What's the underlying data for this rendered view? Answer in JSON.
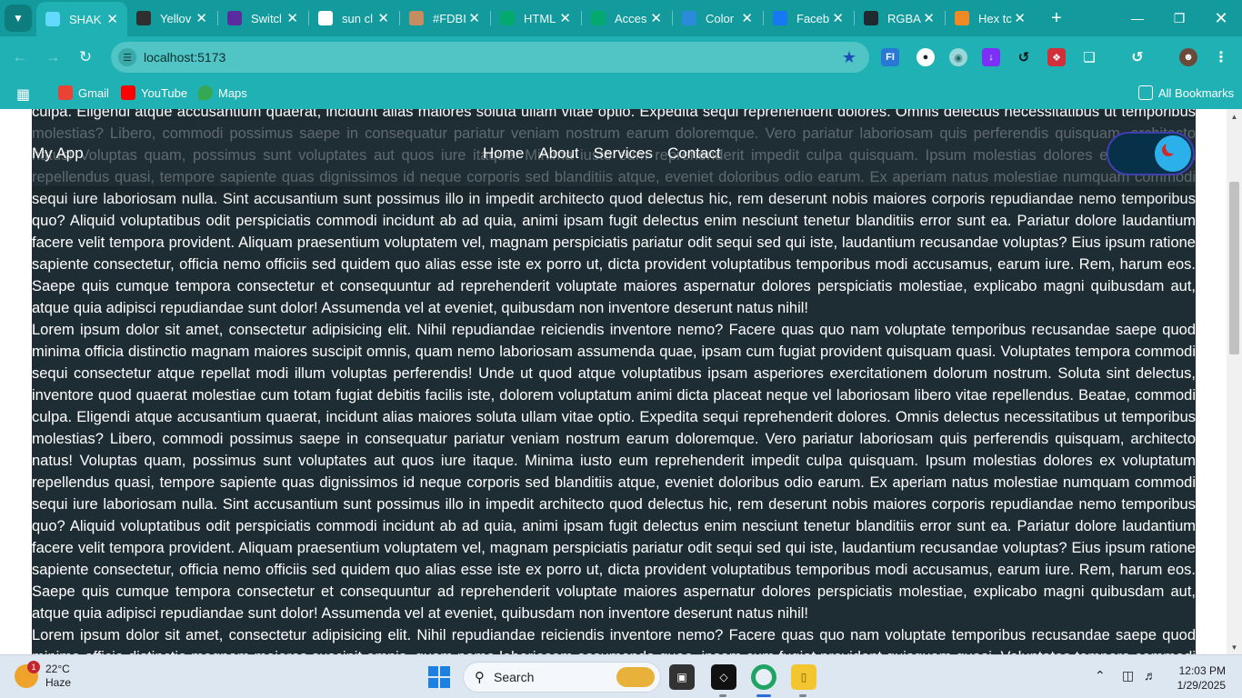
{
  "browser": {
    "tabs": [
      {
        "title": "SHAK",
        "favicon": "react-icon",
        "favicon_color": "#61dafb",
        "active": true
      },
      {
        "title": "Yellov",
        "favicon": "cup-icon",
        "favicon_color": "#2f2f2f",
        "active": false
      },
      {
        "title": "Switcl",
        "favicon": "ui-icon",
        "favicon_color": "#5a2ca0",
        "active": false
      },
      {
        "title": "sun cl",
        "favicon": "google-icon",
        "favicon_color": "#ffffff",
        "active": false
      },
      {
        "title": "#FDBI",
        "favicon": "lock-icon",
        "favicon_color": "#c58d62",
        "active": false
      },
      {
        "title": "HTML",
        "favicon": "w3-icon",
        "favicon_color": "#04aa6d",
        "active": false
      },
      {
        "title": "Acces",
        "favicon": "w3-icon",
        "favicon_color": "#04aa6d",
        "active": false
      },
      {
        "title": "Color",
        "favicon": "wave-icon",
        "favicon_color": "#2b8ad9",
        "active": false
      },
      {
        "title": "Faceb",
        "favicon": "facebook-icon",
        "favicon_color": "#1877f2",
        "active": false
      },
      {
        "title": "RGBA",
        "favicon": "pen-icon",
        "favicon_color": "#1f2a30",
        "active": false
      },
      {
        "title": "Hex tc",
        "favicon": "r-icon",
        "favicon_color": "#f08a24",
        "active": false
      }
    ],
    "address": "localhost:5173",
    "bookmarks": [
      {
        "label": "Gmail",
        "icon": "gmail-icon",
        "color": "#ea4335"
      },
      {
        "label": "YouTube",
        "icon": "youtube-icon",
        "color": "#ff0000"
      },
      {
        "label": "Maps",
        "icon": "maps-icon",
        "color": "#34a853"
      }
    ],
    "all_bookmarks": "All Bookmarks"
  },
  "app": {
    "brand": "My App",
    "nav": [
      "Home",
      "About",
      "Services",
      "Contact"
    ],
    "theme_toggle": {
      "state": "dark",
      "colors": {
        "track": "#073149",
        "knob": "#2bb0ea",
        "moon": "#d22828"
      }
    },
    "background": "#1e2d33",
    "paragraphs": [
      "Lorem ipsum dolor sit amet, consectetur adipisicing elit. Nihil repudiandae reiciendis inventore nemo? Facere quas quo nam voluptate temporibus recusandae saepe quod minima officia distinctio magnam maiores suscipit omnis, quam nemo laboriosam assumenda quae, ipsam cum fugiat provident quisquam quasi. Voluptates tempora commodi sequi consectetur atque repellat modi illum voluptas perferendis! Unde ut quod atque voluptatibus ipsam asperiores exercitationem dolorum nostrum. Soluta sint delectus, inventore quod quaerat molestiae cum totam fugiat debitis facilis iste, dolorem voluptatum animi dicta placeat neque vel laboriosam libero vitae repellendus. Beatae, commodi culpa. Eligendi atque accusantium quaerat, incidunt alias maiores soluta ullam vitae optio. Expedita sequi reprehenderit dolores. Omnis delectus necessitatibus ut temporibus molestias? Libero, commodi possimus saepe in consequatur pariatur veniam nostrum earum doloremque. Vero pariatur laboriosam quis perferendis quisquam, architecto natus! Voluptas quam, possimus sunt voluptates aut quos iure itaque. Minima iusto eum reprehenderit impedit culpa quisquam. Ipsum molestias dolores ex voluptatum repellendus quasi, tempore sapiente quas dignissimos id neque corporis sed blanditiis atque, eveniet doloribus odio earum. Ex aperiam natus molestiae numquam commodi sequi iure laboriosam nulla. Sint accusantium sunt possimus illo in impedit architecto quod delectus hic, rem deserunt nobis maiores corporis repudiandae nemo temporibus quo? Aliquid voluptatibus odit perspiciatis commodi incidunt ab ad quia, animi ipsam fugit delectus enim nesciunt tenetur blanditiis error sunt ea. Pariatur dolore laudantium facere velit tempora provident. Aliquam praesentium voluptatem vel, magnam perspiciatis pariatur odit sequi sed qui iste, laudantium recusandae voluptas? Eius ipsum ratione sapiente consectetur, officia nemo officiis sed quidem quo alias esse iste ex porro ut, dicta provident voluptatibus temporibus modi accusamus, earum iure. Rem, harum eos. Saepe quis cumque tempora consectetur et consequuntur ad reprehenderit voluptate maiores aspernatur dolores perspiciatis molestiae, explicabo magni quibusdam aut, atque quia adipisci repudiandae sunt dolor! Assumenda vel at eveniet, quibusdam non inventore deserunt natus nihil!",
      "Lorem ipsum dolor sit amet, consectetur adipisicing elit. Nihil repudiandae reiciendis inventore nemo? Facere quas quo nam voluptate temporibus recusandae saepe quod minima officia distinctio magnam maiores suscipit omnis, quam nemo laboriosam assumenda quae, ipsam cum fugiat provident quisquam quasi. Voluptates tempora commodi sequi consectetur atque repellat modi illum voluptas perferendis! Unde ut quod atque voluptatibus ipsam asperiores exercitationem dolorum nostrum. Soluta sint delectus, inventore quod quaerat molestiae cum totam fugiat debitis facilis iste, dolorem voluptatum animi dicta placeat neque vel laboriosam libero vitae repellendus. Beatae, commodi culpa. Eligendi atque accusantium quaerat, incidunt alias maiores soluta ullam vitae optio. Expedita sequi reprehenderit dolores. Omnis delectus necessitatibus ut temporibus molestias? Libero, commodi possimus saepe in consequatur pariatur veniam nostrum earum doloremque. Vero pariatur laboriosam quis perferendis quisquam, architecto natus! Voluptas quam, possimus sunt voluptates aut quos iure itaque. Minima iusto eum reprehenderit impedit culpa quisquam. Ipsum molestias dolores ex voluptatum repellendus quasi, tempore sapiente quas dignissimos id neque corporis sed blanditiis atque, eveniet doloribus odio earum. Ex aperiam natus molestiae numquam commodi sequi iure laboriosam nulla. Sint accusantium sunt possimus illo in impedit architecto quod delectus hic, rem deserunt nobis maiores corporis repudiandae nemo temporibus quo? Aliquid voluptatibus odit perspiciatis commodi incidunt ab ad quia, animi ipsam fugit delectus enim nesciunt tenetur blanditiis error sunt ea. Pariatur dolore laudantium facere velit tempora provident. Aliquam praesentium voluptatem vel, magnam perspiciatis pariatur odit sequi sed qui iste, laudantium recusandae voluptas? Eius ipsum ratione sapiente consectetur, officia nemo officiis sed quidem quo alias esse iste ex porro ut, dicta provident voluptatibus temporibus modi accusamus, earum iure. Rem, harum eos. Saepe quis cumque tempora consectetur et consequuntur ad reprehenderit voluptate maiores aspernatur dolores perspiciatis molestiae, explicabo magni quibusdam aut, atque quia adipisci repudiandae sunt dolor! Assumenda vel at eveniet, quibusdam non inventore deserunt natus nihil!",
      "Lorem ipsum dolor sit amet, consectetur adipisicing elit. Nihil repudiandae reiciendis inventore nemo? Facere quas quo nam voluptate temporibus recusandae saepe quod minima officia distinctio magnam maiores suscipit omnis, quam nemo laboriosam assumenda quae, ipsam cum fugiat provident quisquam quasi. Voluptates tempora commodi sequi consectetur atque repellat modi illum voluptas perferendis!"
    ]
  },
  "taskbar": {
    "weather_temp": "22°C",
    "weather_desc": "Haze",
    "weather_badge": "1",
    "search_placeholder": "Search",
    "time": "12:03 PM",
    "date": "1/29/2025"
  }
}
